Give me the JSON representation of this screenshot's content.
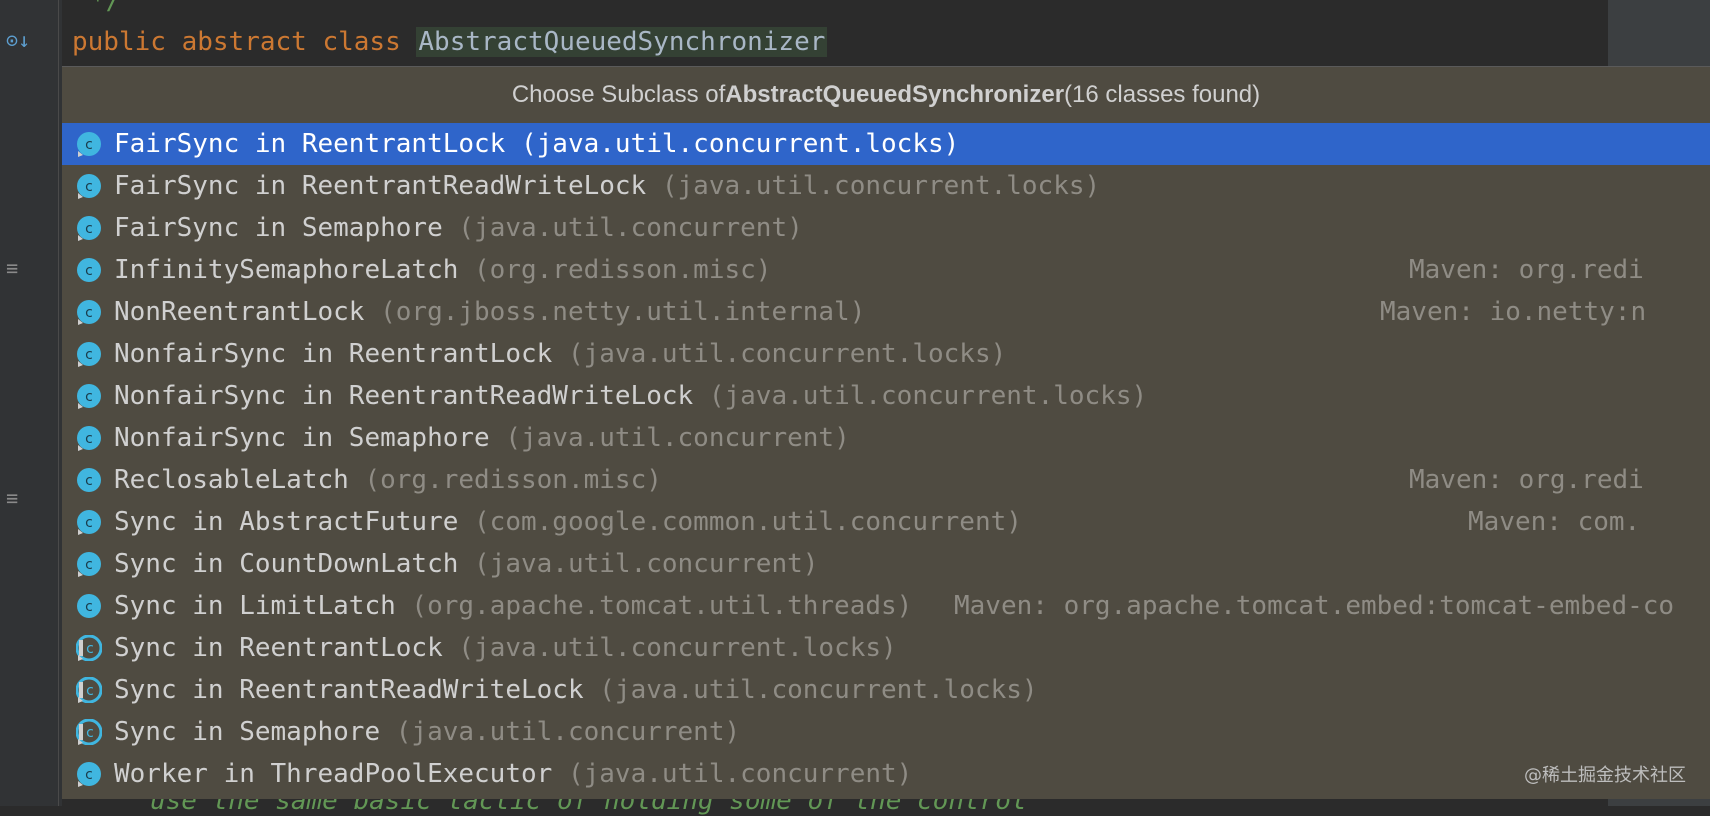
{
  "editor": {
    "comment_end": "*/",
    "keyword_public": "public",
    "keyword_abstract": "abstract",
    "keyword_class": "class",
    "class_name": "AbstractQueuedSynchronizer",
    "bottom_comment": "use the same basic tactic of holding some of the control"
  },
  "popup": {
    "title_prefix": "Choose Subclass of ",
    "title_class": "AbstractQueuedSynchronizer",
    "title_suffix": " (16 classes found)",
    "selected_index": 0,
    "items": [
      {
        "name": "FairSync in ReentrantLock",
        "package": "(java.util.concurrent.locks)",
        "maven": "",
        "icon": "inner-class-icon"
      },
      {
        "name": "FairSync in ReentrantReadWriteLock",
        "package": "(java.util.concurrent.locks)",
        "maven": "",
        "icon": "inner-class-icon"
      },
      {
        "name": "FairSync in Semaphore",
        "package": "(java.util.concurrent)",
        "maven": "",
        "icon": "inner-class-icon"
      },
      {
        "name": "InfinitySemaphoreLatch",
        "package": "(org.redisson.misc)",
        "maven": "Maven: org.redi",
        "icon": "class-icon"
      },
      {
        "name": "NonReentrantLock",
        "package": "(org.jboss.netty.util.internal)",
        "maven": "Maven: io.netty:n",
        "icon": "inner-class-icon"
      },
      {
        "name": "NonfairSync in ReentrantLock",
        "package": "(java.util.concurrent.locks)",
        "maven": "",
        "icon": "inner-class-icon"
      },
      {
        "name": "NonfairSync in ReentrantReadWriteLock",
        "package": "(java.util.concurrent.locks)",
        "maven": "",
        "icon": "inner-class-icon"
      },
      {
        "name": "NonfairSync in Semaphore",
        "package": "(java.util.concurrent)",
        "maven": "",
        "icon": "inner-class-icon"
      },
      {
        "name": "ReclosableLatch",
        "package": "(org.redisson.misc)",
        "maven": "Maven: org.redi",
        "icon": "class-icon"
      },
      {
        "name": "Sync in AbstractFuture",
        "package": "(com.google.common.util.concurrent)",
        "maven": "Maven: com.",
        "icon": "inner-class-icon"
      },
      {
        "name": "Sync in CountDownLatch",
        "package": "(java.util.concurrent)",
        "maven": "",
        "icon": "inner-class-icon"
      },
      {
        "name": "Sync in LimitLatch",
        "package": "(org.apache.tomcat.util.threads)",
        "maven": "Maven: org.apache.tomcat.embed:tomcat-embed-co",
        "icon": "class-icon"
      },
      {
        "name": "Sync in ReentrantLock",
        "package": "(java.util.concurrent.locks)",
        "maven": "",
        "icon": "abstract-inner-class-icon"
      },
      {
        "name": "Sync in ReentrantReadWriteLock",
        "package": "(java.util.concurrent.locks)",
        "maven": "",
        "icon": "abstract-inner-class-icon"
      },
      {
        "name": "Sync in Semaphore",
        "package": "(java.util.concurrent)",
        "maven": "",
        "icon": "abstract-inner-class-icon"
      },
      {
        "name": "Worker in ThreadPoolExecutor",
        "package": "(java.util.concurrent)",
        "maven": "",
        "icon": "inner-class-icon"
      }
    ]
  },
  "watermark": "@稀土掘金技术社区",
  "colors": {
    "popup_bg": "#4f4b41",
    "selection": "#2f65ca",
    "class_icon": "#40b6e0"
  }
}
